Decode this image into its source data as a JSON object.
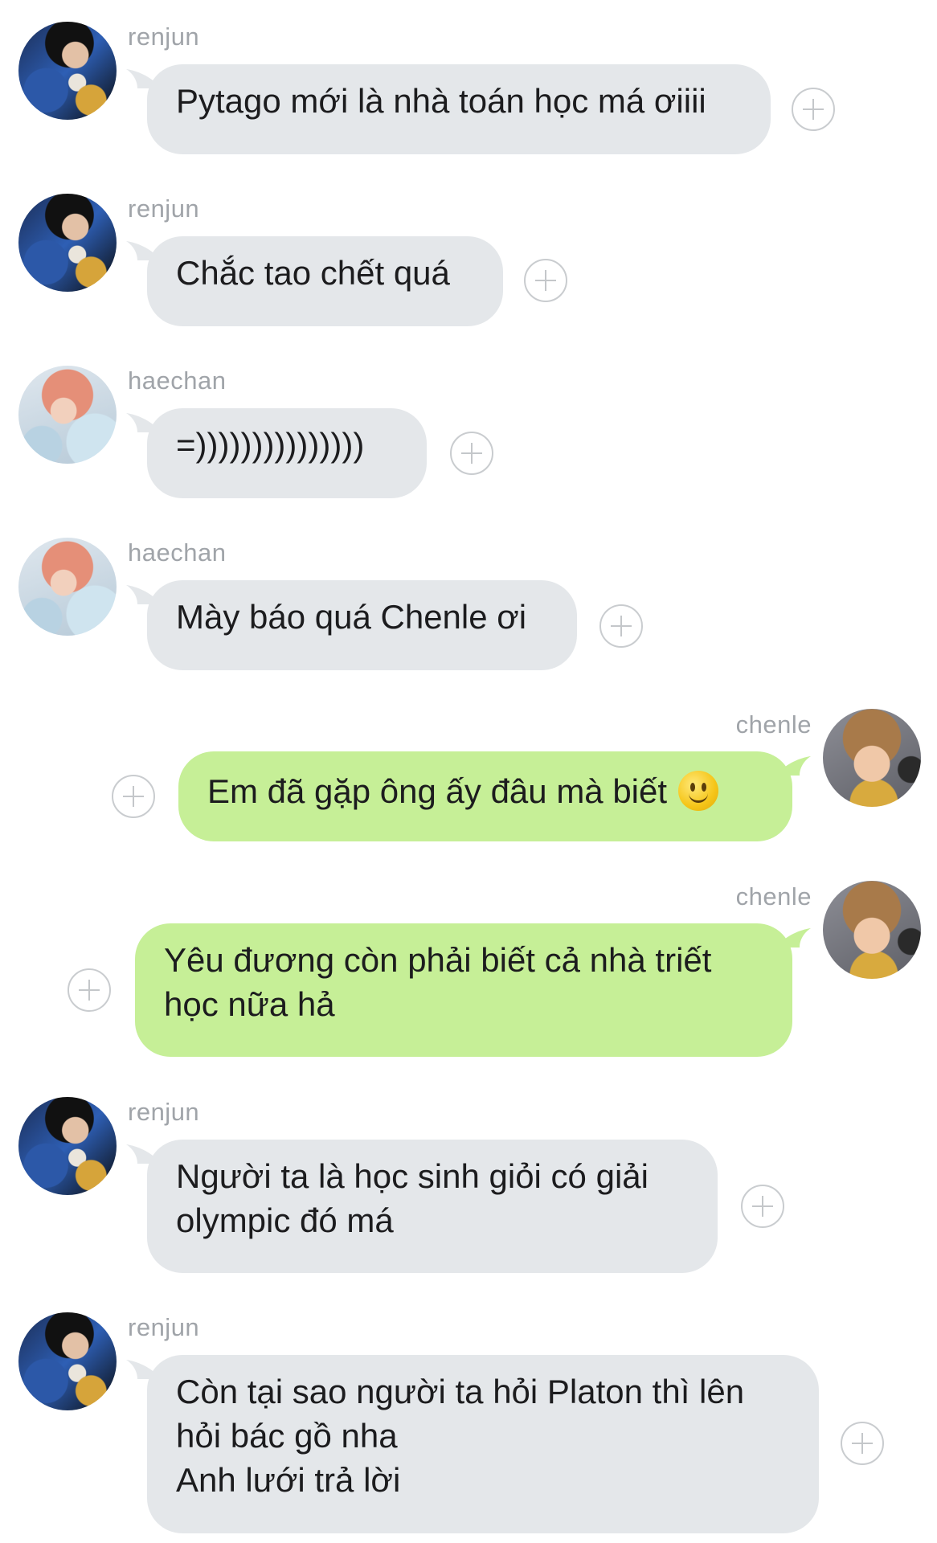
{
  "colors": {
    "incoming_bubble": "#e4e7ea",
    "outgoing_bubble": "#c6ef97",
    "sender_name": "#a0a4a9",
    "add_button": "#c4c7ca",
    "message_text": "#1c1c1e"
  },
  "messages": [
    {
      "sender": "renjun",
      "direction": "incoming",
      "lines": [
        "Pytago mới là nhà toán học má ơiiii"
      ]
    },
    {
      "sender": "renjun",
      "direction": "incoming",
      "lines": [
        "Chắc tao chết quá"
      ]
    },
    {
      "sender": "haechan",
      "direction": "incoming",
      "lines": [
        "=)))))))))))))))"
      ]
    },
    {
      "sender": "haechan",
      "direction": "incoming",
      "lines": [
        "Mày báo quá Chenle ơi"
      ]
    },
    {
      "sender": "chenle",
      "direction": "outgoing",
      "lines": [
        "Em đã gặp ông ấy đâu mà biết"
      ],
      "emoji": "slightly-smiling-face-emoji"
    },
    {
      "sender": "chenle",
      "direction": "outgoing",
      "lines": [
        "Yêu đương còn phải biết cả nhà triết",
        "học nữa hả"
      ]
    },
    {
      "sender": "renjun",
      "direction": "incoming",
      "lines": [
        "Người ta là học sinh giỏi có giải",
        "olympic đó má"
      ]
    },
    {
      "sender": "renjun",
      "direction": "incoming",
      "lines": [
        "Còn tại sao người ta hỏi Platon thì lên",
        "hỏi bác gồ nha",
        "Anh lưới trả lời"
      ]
    }
  ],
  "icons": {
    "add_reaction": "plus-circle-icon",
    "avatar_renjun": "avatar-renjun",
    "avatar_haechan": "avatar-haechan",
    "avatar_chenle": "avatar-chenle"
  }
}
